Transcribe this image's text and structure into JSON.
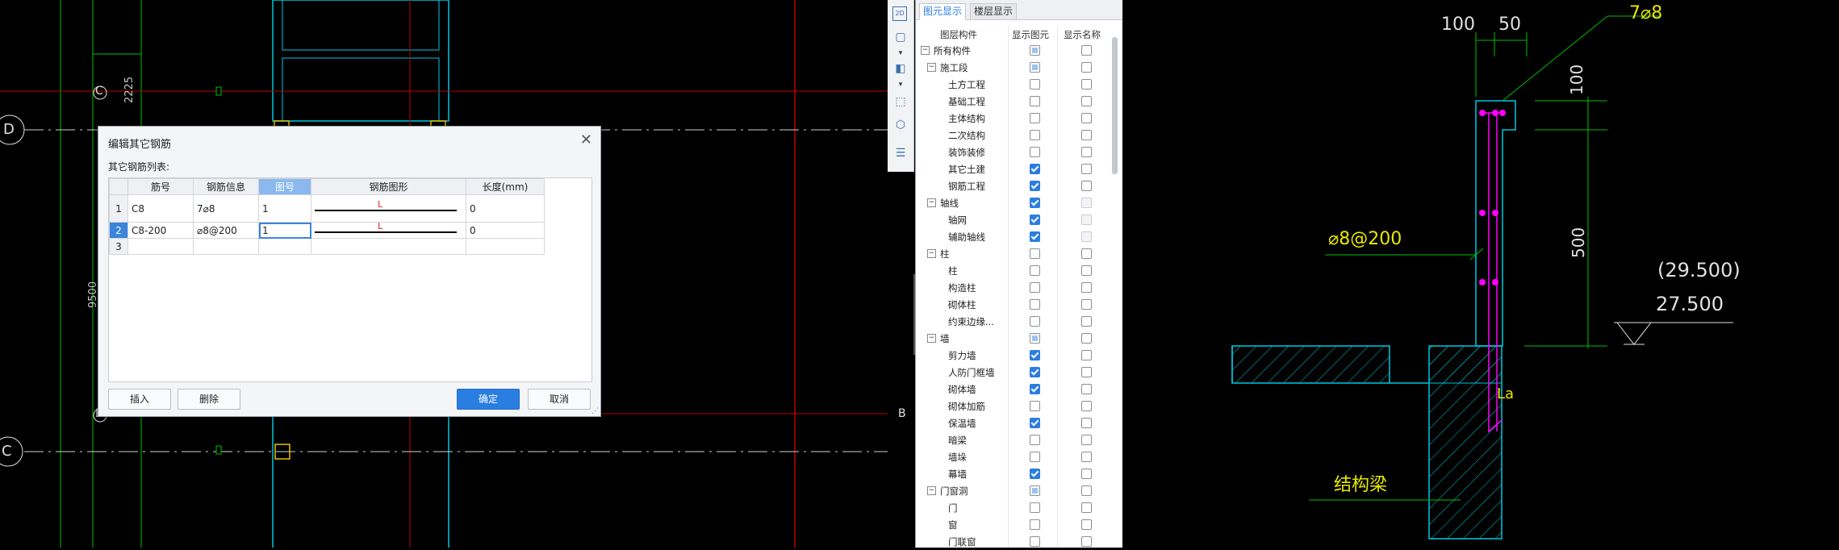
{
  "dialog": {
    "title": "编辑其它钢筋",
    "subtitle": "其它钢筋列表:",
    "columns": [
      "筋号",
      "钢筋信息",
      "图号",
      "钢筋图形",
      "长度(mm)"
    ],
    "rows": [
      {
        "num": "1",
        "name": "C8",
        "info": "7⌀8",
        "fig": "1",
        "shape_mark": "L",
        "length": "0"
      },
      {
        "num": "2",
        "name": "C8-200",
        "info": "⌀8@200",
        "fig": "1",
        "shape_mark": "L",
        "length": "0"
      },
      {
        "num": "3",
        "name": "",
        "info": "",
        "fig": "",
        "shape_mark": "",
        "length": ""
      }
    ],
    "buttons": {
      "insert": "插入",
      "delete": "删除",
      "ok": "确定",
      "cancel": "取消"
    }
  },
  "panel": {
    "tabs": [
      "图元显示",
      "楼层显示"
    ],
    "headers": [
      "图层构件",
      "显示图元",
      "显示名称"
    ],
    "items": [
      {
        "label": "所有构件",
        "level": 0,
        "toggle": "−",
        "show": "partial",
        "name": "off"
      },
      {
        "label": "施工段",
        "level": 1,
        "toggle": "−",
        "show": "partial",
        "name": "off"
      },
      {
        "label": "土方工程",
        "level": 2,
        "toggle": "",
        "show": "off",
        "name": "off"
      },
      {
        "label": "基础工程",
        "level": 2,
        "toggle": "",
        "show": "off",
        "name": "off"
      },
      {
        "label": "主体结构",
        "level": 2,
        "toggle": "",
        "show": "off",
        "name": "off"
      },
      {
        "label": "二次结构",
        "level": 2,
        "toggle": "",
        "show": "off",
        "name": "off"
      },
      {
        "label": "装饰装修",
        "level": 2,
        "toggle": "",
        "show": "off",
        "name": "off"
      },
      {
        "label": "其它土建",
        "level": 2,
        "toggle": "",
        "show": "on",
        "name": "off"
      },
      {
        "label": "钢筋工程",
        "level": 2,
        "toggle": "",
        "show": "on",
        "name": "off"
      },
      {
        "label": "轴线",
        "level": 1,
        "toggle": "−",
        "show": "on",
        "name": "dis"
      },
      {
        "label": "轴网",
        "level": 2,
        "toggle": "",
        "show": "on",
        "name": "dis"
      },
      {
        "label": "辅助轴线",
        "level": 2,
        "toggle": "",
        "show": "on",
        "name": "dis"
      },
      {
        "label": "柱",
        "level": 1,
        "toggle": "−",
        "show": "off",
        "name": "off"
      },
      {
        "label": "柱",
        "level": 2,
        "toggle": "",
        "show": "off",
        "name": "off"
      },
      {
        "label": "构造柱",
        "level": 2,
        "toggle": "",
        "show": "off",
        "name": "off"
      },
      {
        "label": "砌体柱",
        "level": 2,
        "toggle": "",
        "show": "off",
        "name": "off"
      },
      {
        "label": "约束边缘...",
        "level": 2,
        "toggle": "",
        "show": "off",
        "name": "off"
      },
      {
        "label": "墙",
        "level": 1,
        "toggle": "−",
        "show": "partial",
        "name": "off"
      },
      {
        "label": "剪力墙",
        "level": 2,
        "toggle": "",
        "show": "on",
        "name": "off"
      },
      {
        "label": "人防门框墙",
        "level": 2,
        "toggle": "",
        "show": "on",
        "name": "off"
      },
      {
        "label": "砌体墙",
        "level": 2,
        "toggle": "",
        "show": "on",
        "name": "off"
      },
      {
        "label": "砌体加筋",
        "level": 2,
        "toggle": "",
        "show": "off",
        "name": "off"
      },
      {
        "label": "保温墙",
        "level": 2,
        "toggle": "",
        "show": "on",
        "name": "off"
      },
      {
        "label": "暗梁",
        "level": 2,
        "toggle": "",
        "show": "off",
        "name": "off"
      },
      {
        "label": "墙垛",
        "level": 2,
        "toggle": "",
        "show": "off",
        "name": "off"
      },
      {
        "label": "幕墙",
        "level": 2,
        "toggle": "",
        "show": "on",
        "name": "off"
      },
      {
        "label": "门窗洞",
        "level": 1,
        "toggle": "−",
        "show": "partial",
        "name": "off"
      },
      {
        "label": "门",
        "level": 2,
        "toggle": "",
        "show": "off",
        "name": "off"
      },
      {
        "label": "窗",
        "level": 2,
        "toggle": "",
        "show": "off",
        "name": "off"
      },
      {
        "label": "门联窗",
        "level": 2,
        "toggle": "",
        "show": "off",
        "name": "off"
      }
    ]
  },
  "toolbar": {
    "icons": [
      "2d-view-icon",
      "3d-box-icon",
      "chevron-down-icon",
      "3d-solid-icon",
      "chevron-down-icon",
      "select-region-icon",
      "layer-settings-icon",
      "display-list-icon"
    ],
    "label_2d": "2D"
  },
  "cad_left": {
    "axis_labels": [
      "D",
      "C",
      "C",
      "B",
      "B"
    ],
    "dims": [
      "2225",
      "9500"
    ]
  },
  "cad_right": {
    "dims": [
      "100",
      "50",
      "100",
      "500"
    ],
    "rebar_top": "7⌀8",
    "rebar_side": "⌀8@200",
    "elev_1": "(29.500)",
    "elev_2": "27.500",
    "beam_label": "结构梁",
    "la_label": "La"
  },
  "colors": {
    "accent": "#2a7de1",
    "cad_cyan": "#00e5ff",
    "cad_yellow": "#e8e800",
    "cad_green": "#00d000",
    "cad_red": "#ff2020",
    "cad_magenta": "#ff00ff"
  }
}
